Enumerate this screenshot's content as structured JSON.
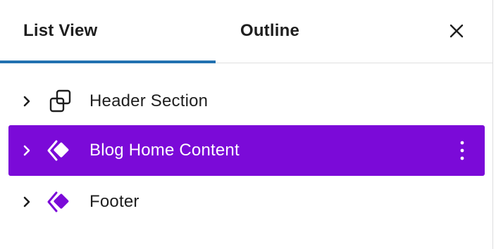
{
  "tabs": {
    "list_view": "List View",
    "outline": "Outline",
    "active": "List View"
  },
  "close_icon": "close-icon",
  "rows": [
    {
      "label": "Header Section",
      "icon": "group-icon",
      "expand_icon": "chevron-right-icon",
      "selected": false
    },
    {
      "label": "Blog Home Content",
      "icon": "template-part-icon",
      "expand_icon": "chevron-right-icon",
      "selected": true,
      "options_icon": "more-vertical-icon"
    },
    {
      "label": "Footer",
      "icon": "template-part-icon",
      "expand_icon": "chevron-right-icon",
      "selected": false
    }
  ],
  "colors": {
    "selected_bg": "#7b0ad8",
    "tab_indicator": "#2271b1",
    "icon_purple": "#7b0ad8",
    "text": "#1e1e1e"
  }
}
